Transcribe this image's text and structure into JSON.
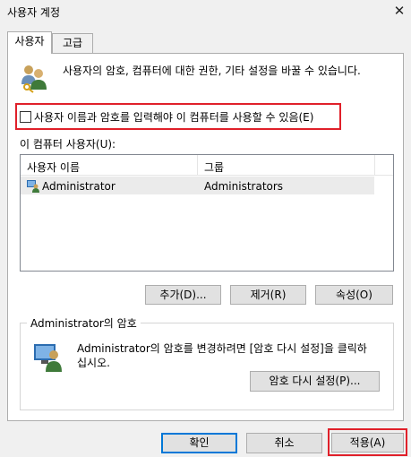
{
  "window": {
    "title": "사용자 계정",
    "close_glyph": "✕"
  },
  "tabs": [
    {
      "label": "사용자",
      "active": true
    },
    {
      "label": "고급",
      "active": false
    }
  ],
  "users_tab": {
    "description": "사용자의 암호, 컴퓨터에 대한 권한, 기타 설정을 바꿀 수 있습니다.",
    "require_login_checkbox": {
      "label": "사용자 이름과 암호를 입력해야 이 컴퓨터를 사용할 수 있음(E)",
      "checked": false
    },
    "users_label": "이 컴퓨터 사용자(U):",
    "table": {
      "columns": [
        "사용자 이름",
        "그룹"
      ],
      "rows": [
        {
          "user": "Administrator",
          "group": "Administrators",
          "icon": "users-icon"
        }
      ]
    },
    "buttons": {
      "add": "추가(D)...",
      "remove": "제거(R)",
      "properties": "속성(O)"
    },
    "password_group": {
      "legend": "Administrator의 암호",
      "text_line1": "Administrator의 암호를 변경하려면 [암호 다시 설정]을 클릭하",
      "text_line2": "십시오.",
      "reset_button": "암호 다시 설정(P)..."
    }
  },
  "footer": {
    "ok": "확인",
    "cancel": "취소",
    "apply": "적용(A)"
  },
  "colors": {
    "highlight_border": "#e0202a",
    "focus_border": "#0078d7"
  }
}
